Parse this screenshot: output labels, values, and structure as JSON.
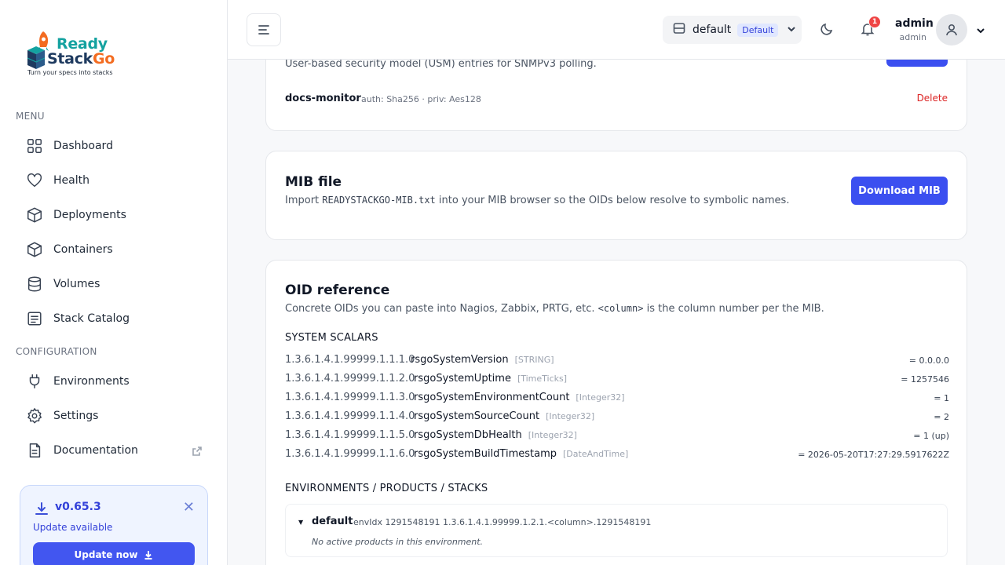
{
  "brand": {
    "word1": "Ready",
    "word2a": "Stack",
    "word2b": "Go",
    "tagline": "Turn your specs into stacks",
    "colors": {
      "teal": "#14a2a0",
      "navy": "#1e3a5f",
      "orange": "#f36c21"
    }
  },
  "sidebar": {
    "menu_heading": "MENU",
    "menu_items": [
      {
        "label": "Dashboard",
        "icon": "grid-icon"
      },
      {
        "label": "Health",
        "icon": "heart-icon"
      },
      {
        "label": "Deployments",
        "icon": "cube-icon"
      },
      {
        "label": "Containers",
        "icon": "box-icon"
      },
      {
        "label": "Volumes",
        "icon": "database-icon"
      },
      {
        "label": "Stack Catalog",
        "icon": "list-icon"
      }
    ],
    "config_heading": "CONFIGURATION",
    "config_items": [
      {
        "label": "Environments",
        "icon": "plug-icon"
      },
      {
        "label": "Settings",
        "icon": "gear-icon"
      },
      {
        "label": "Documentation",
        "icon": "document-icon"
      }
    ],
    "update": {
      "version": "v0.65.3",
      "status": "Update available",
      "button": "Update now"
    }
  },
  "header": {
    "environment": {
      "name": "default",
      "badge": "Default"
    },
    "notifications_count": "1",
    "user": {
      "name": "admin",
      "role": "admin"
    }
  },
  "usm_card": {
    "description": "User-based security model (USM) entries for SNMPv3 polling.",
    "entries": [
      {
        "name": "docs-monitor",
        "meta": "auth: Sha256 · priv: Aes128",
        "action": "Delete"
      }
    ]
  },
  "mib_card": {
    "title": "MIB file",
    "desc_pre": "Import ",
    "desc_code": "READYSTACKGO-MIB.txt",
    "desc_post": " into your MIB browser so the OIDs below resolve to symbolic names.",
    "button": "Download MIB"
  },
  "oid_card": {
    "title": "OID reference",
    "desc_pre": "Concrete OIDs you can paste into Nagios, Zabbix, PRTG, etc. ",
    "desc_code": "<column>",
    "desc_post": " is the column number per the MIB.",
    "scalars_heading": "SYSTEM SCALARS",
    "scalars": [
      {
        "oid": "1.3.6.1.4.1.99999.1.1.1.0",
        "name": "rsgoSystemVersion",
        "type": "[STRING]",
        "value": "= 0.0.0.0"
      },
      {
        "oid": "1.3.6.1.4.1.99999.1.1.2.0",
        "name": "rsgoSystemUptime",
        "type": "[TimeTicks]",
        "value": "= 1257546"
      },
      {
        "oid": "1.3.6.1.4.1.99999.1.1.3.0",
        "name": "rsgoSystemEnvironmentCount",
        "type": "[Integer32]",
        "value": "= 1"
      },
      {
        "oid": "1.3.6.1.4.1.99999.1.1.4.0",
        "name": "rsgoSystemSourceCount",
        "type": "[Integer32]",
        "value": "= 2"
      },
      {
        "oid": "1.3.6.1.4.1.99999.1.1.5.0",
        "name": "rsgoSystemDbHealth",
        "type": "[Integer32]",
        "value": "= 1 (up)"
      },
      {
        "oid": "1.3.6.1.4.1.99999.1.1.6.0",
        "name": "rsgoSystemBuildTimestamp",
        "type": "[DateAndTime]",
        "value": "= 2026-05-20T17:27:29.5917622Z"
      }
    ],
    "env_heading": "ENVIRONMENTS / PRODUCTS / STACKS",
    "environments": [
      {
        "name": "default",
        "meta": "envIdx 1291548191   1.3.6.1.4.1.99999.1.2.1.<column>.1291548191",
        "empty": "No active products in this environment."
      }
    ]
  }
}
